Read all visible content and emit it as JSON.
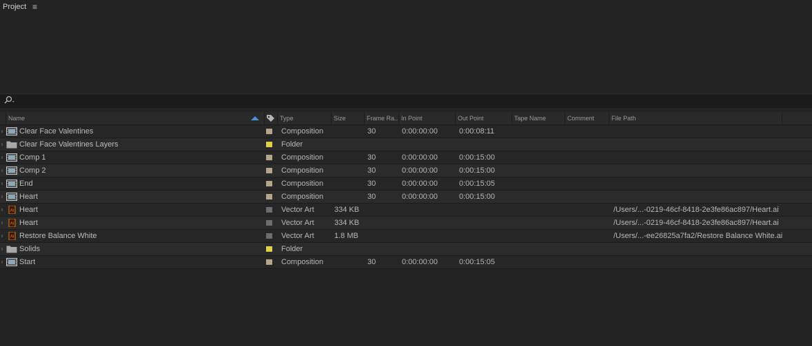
{
  "panel": {
    "title": "Project",
    "menu_icon": "≡"
  },
  "search": {
    "placeholder": "",
    "value": ""
  },
  "columns": [
    "Name",
    "Type",
    "Size",
    "Frame Ra...",
    "In Point",
    "Out Point",
    "Tape Name",
    "Comment",
    "File Path"
  ],
  "label_colors": {
    "composition": "#b5a58a",
    "folder": "#e0d145",
    "vector": "#6d6d6d"
  },
  "items": [
    {
      "name": "Clear Face Valentines",
      "icon": "composition-icon",
      "label": "composition",
      "type": "Composition",
      "size": "",
      "fps": "30",
      "in": "0:00:00:00",
      "out": "0:00:08:11",
      "path": ""
    },
    {
      "name": "Clear Face Valentines Layers",
      "icon": "folder-icon",
      "label": "folder",
      "type": "Folder",
      "size": "",
      "fps": "",
      "in": "",
      "out": "",
      "path": ""
    },
    {
      "name": "Comp 1",
      "icon": "composition-icon",
      "label": "composition",
      "type": "Composition",
      "size": "",
      "fps": "30",
      "in": "0:00:00:00",
      "out": "0:00:15:00",
      "path": ""
    },
    {
      "name": "Comp 2",
      "icon": "composition-icon",
      "label": "composition",
      "type": "Composition",
      "size": "",
      "fps": "30",
      "in": "0:00:00:00",
      "out": "0:00:15:00",
      "path": ""
    },
    {
      "name": "End",
      "icon": "composition-icon",
      "label": "composition",
      "type": "Composition",
      "size": "",
      "fps": "30",
      "in": "0:00:00:00",
      "out": "0:00:15:05",
      "path": ""
    },
    {
      "name": "Heart",
      "icon": "composition-icon",
      "label": "composition",
      "type": "Composition",
      "size": "",
      "fps": "30",
      "in": "0:00:00:00",
      "out": "0:00:15:00",
      "path": ""
    },
    {
      "name": "Heart",
      "icon": "illustrator-file-icon",
      "label": "vector",
      "type": "Vector Art",
      "size": "334 KB",
      "fps": "",
      "in": "",
      "out": "",
      "path": "/Users/...-0219-46cf-8418-2e3fe86ac897/Heart.ai"
    },
    {
      "name": "Heart",
      "icon": "illustrator-file-icon",
      "label": "vector",
      "type": "Vector Art",
      "size": "334 KB",
      "fps": "",
      "in": "",
      "out": "",
      "path": "/Users/...-0219-46cf-8418-2e3fe86ac897/Heart.ai"
    },
    {
      "name": "Restore Balance White",
      "icon": "illustrator-file-icon",
      "label": "vector",
      "type": "Vector Art",
      "size": "1.8 MB",
      "fps": "",
      "in": "",
      "out": "",
      "path": "/Users/...-ee26825a7fa2/Restore Balance White.ai"
    },
    {
      "name": "Solids",
      "icon": "folder-icon",
      "label": "folder",
      "type": "Folder",
      "size": "",
      "fps": "",
      "in": "",
      "out": "",
      "path": ""
    },
    {
      "name": "Start",
      "icon": "composition-icon",
      "label": "composition",
      "type": "Composition",
      "size": "",
      "fps": "30",
      "in": "0:00:00:00",
      "out": "0:00:15:05",
      "path": ""
    }
  ]
}
